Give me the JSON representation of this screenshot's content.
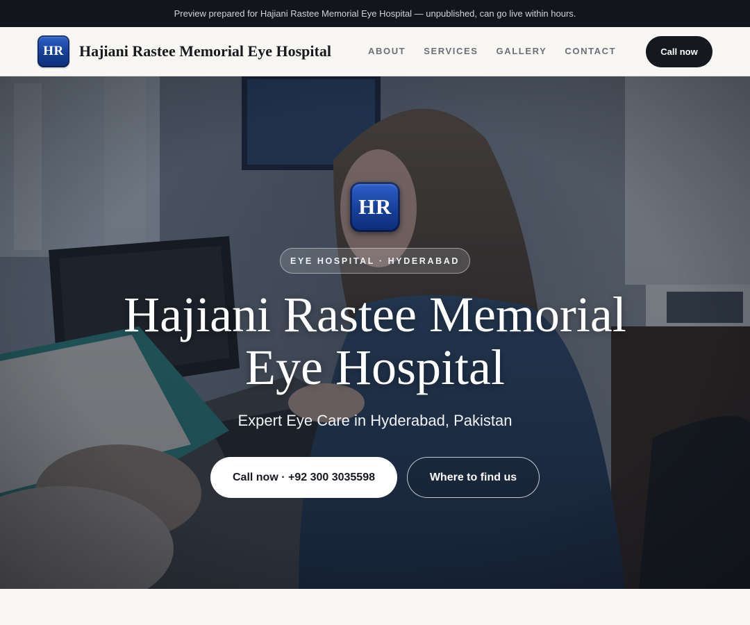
{
  "banner": {
    "text": "Preview prepared for Hajiani Rastee Memorial Eye Hospital — unpublished, can go live within hours."
  },
  "header": {
    "logo_initials": "HR",
    "site_title": "Hajiani Rastee Memorial Eye Hospital",
    "nav": [
      {
        "label": "ABOUT"
      },
      {
        "label": "SERVICES"
      },
      {
        "label": "GALLERY"
      },
      {
        "label": "CONTACT"
      }
    ],
    "call_button": "Call now"
  },
  "hero": {
    "badge_initials": "HR",
    "pill": "EYE HOSPITAL · HYDERABAD",
    "title_line1": "Hajiani Rastee Memorial",
    "title_line2": "Eye Hospital",
    "subtitle": "Expert Eye Care in Hyderabad, Pakistan",
    "primary_button": "Call now · +92 300 3035598",
    "secondary_button": "Where to find us",
    "background_image": "hospital-staff-at-computer-photo"
  },
  "colors": {
    "banner_bg": "#12151b",
    "header_bg": "#f8f7f3",
    "dark_button": "#15181e",
    "logo_blue": "#173f9a",
    "nav_text": "#6b6f78"
  }
}
